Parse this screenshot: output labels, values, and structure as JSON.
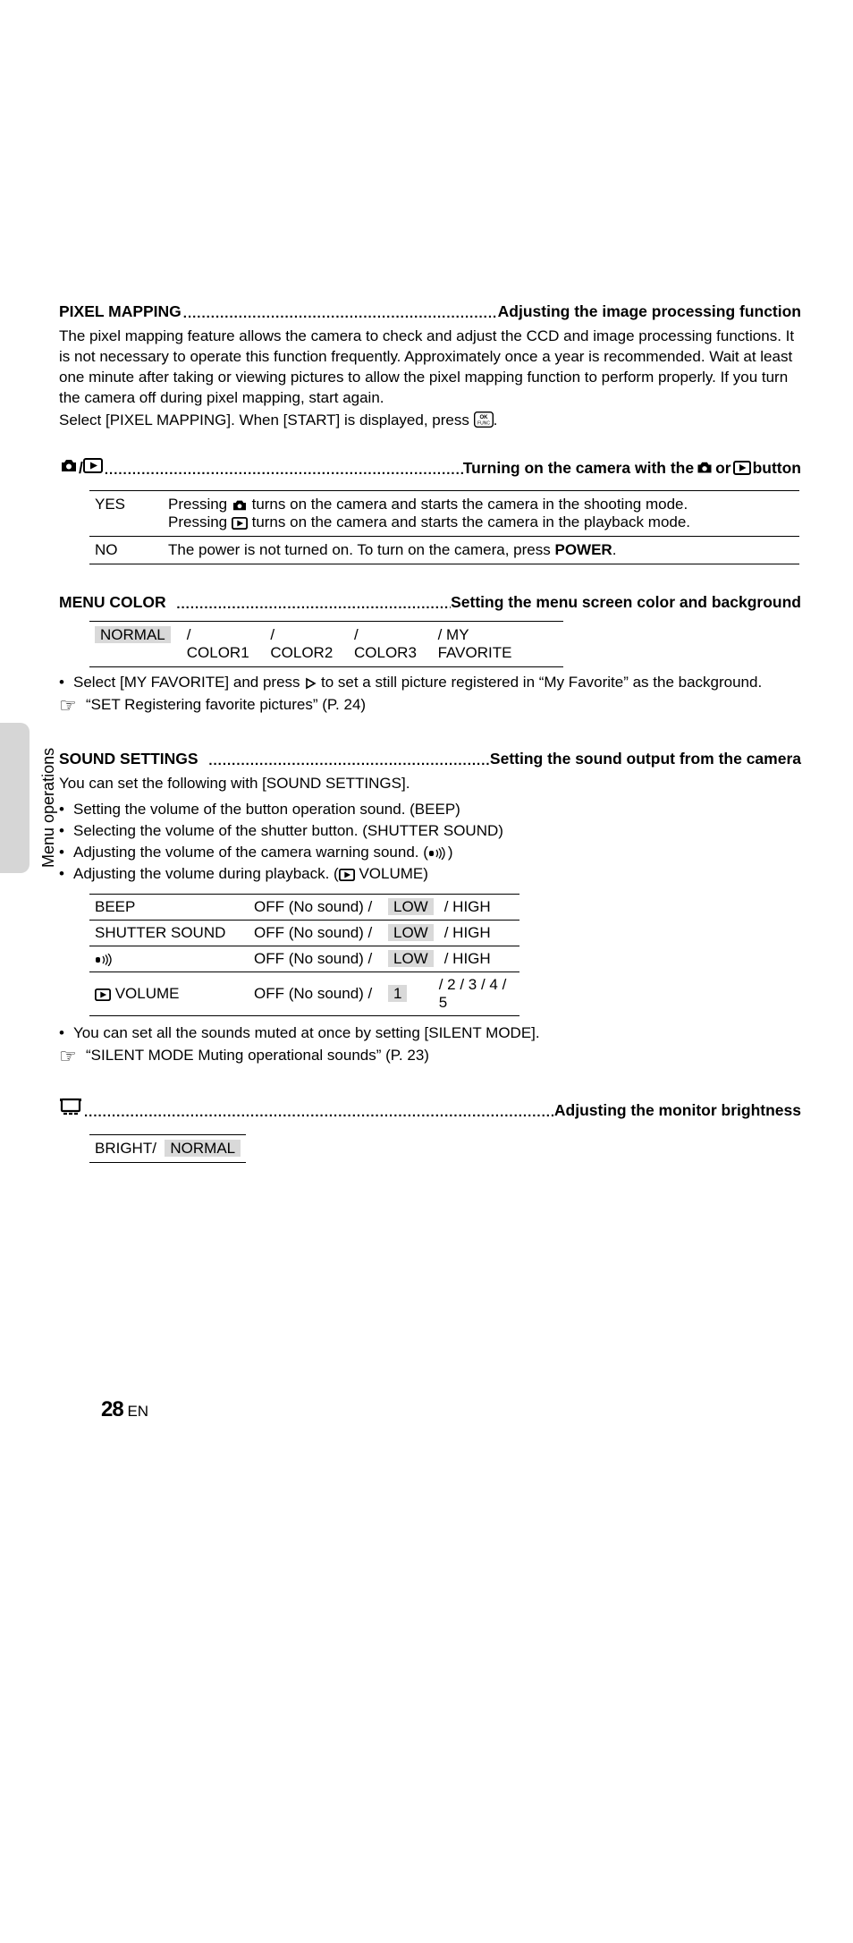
{
  "sidebar": {
    "label": "Menu operations"
  },
  "page": {
    "number": "28",
    "lang": "EN"
  },
  "s1": {
    "title": "PIXEL MAPPING",
    "subtitle": "Adjusting the image processing function",
    "para": "The pixel mapping feature allows the camera to check and adjust the CCD and image processing functions. It is not necessary to operate this function frequently. Approximately once a year is recommended. Wait at least one minute after taking or viewing pictures to allow the pixel mapping function to perform properly. If you turn the camera off during pixel mapping, start again.",
    "select_prefix": "Select [PIXEL MAPPING]. When [START] is displayed, press ",
    "select_suffix": "."
  },
  "s2": {
    "subtitle_prefix": "Turning on the camera with the ",
    "subtitle_mid": " or ",
    "subtitle_suffix": " button",
    "yes": "YES",
    "no": "NO",
    "yes_pre1": "Pressing ",
    "yes_post1": " turns on the camera and starts the camera in the shooting mode.",
    "yes_pre2": "Pressing ",
    "yes_post2": " turns on the camera and starts the camera in the playback mode.",
    "no_text_pre": "The power is not turned on. To turn on the camera, press ",
    "no_power": "POWER",
    "no_text_post": "."
  },
  "s3": {
    "title": "MENU COLOR",
    "subtitle": "Setting the menu screen color and background",
    "opts": [
      "NORMAL",
      "/ COLOR1",
      "/ COLOR2",
      "/ COLOR3",
      "/ MY FAVORITE"
    ],
    "bullet_pre": "Select [MY FAVORITE] and press ",
    "bullet_post": " to set a still picture registered in “My Favorite” as the background.",
    "ref": "“SET Registering favorite pictures” (P. 24)"
  },
  "s4": {
    "title": "SOUND SETTINGS",
    "subtitle": "Setting the sound output from the camera",
    "intro": "You can set the following with [SOUND SETTINGS].",
    "b1": "Setting the volume of the button operation sound. (BEEP)",
    "b2": "Selecting the volume of the shutter button. (SHUTTER SOUND)",
    "b3_pre": "Adjusting the volume of the camera warning sound. (",
    "b3_post": ")",
    "b4_pre": "Adjusting the volume during playback. (",
    "b4_post": " VOLUME)",
    "rows": {
      "r1": {
        "name": "BEEP",
        "c2": "OFF (No sound) /",
        "c3": "LOW",
        "c4": "/ HIGH"
      },
      "r2": {
        "name": "SHUTTER SOUND",
        "c2": "OFF (No sound) /",
        "c3": "LOW",
        "c4": "/ HIGH"
      },
      "r3": {
        "c2": "OFF (No sound) /",
        "c3": "LOW",
        "c4": "/ HIGH"
      },
      "r4": {
        "name": " VOLUME",
        "c2": "OFF (No sound) /",
        "c3": "1",
        "c4": " / 2 / 3 / 4 / 5"
      }
    },
    "note": "You can set all the sounds muted at once by setting [SILENT MODE].",
    "ref": "“SILENT MODE Muting operational sounds” (P. 23)"
  },
  "s5": {
    "subtitle": "Adjusting the monitor brightness",
    "opt1": "BRIGHT/",
    "opt2": "NORMAL"
  }
}
